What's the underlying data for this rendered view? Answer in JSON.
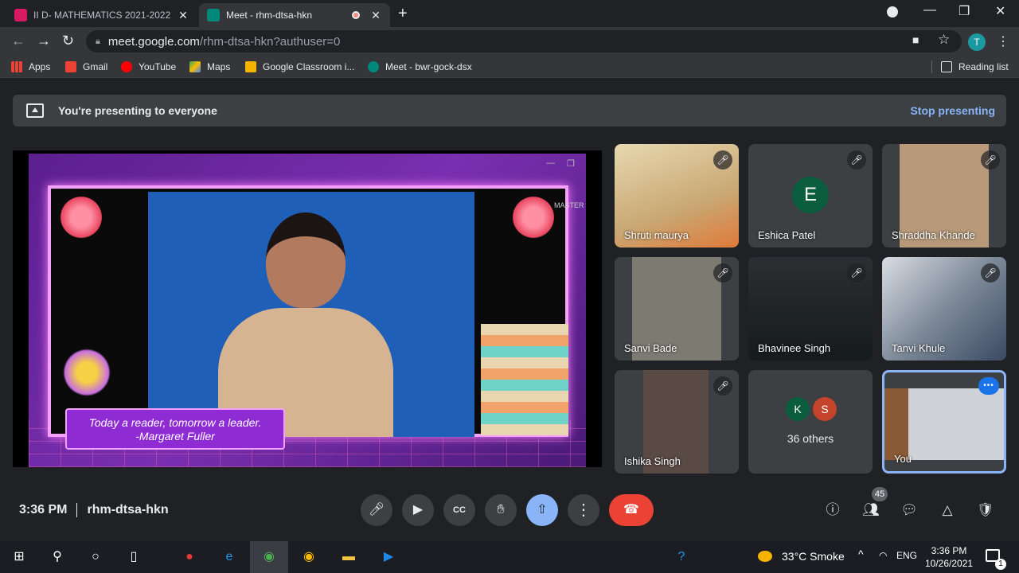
{
  "browser": {
    "tabs": [
      {
        "title": "II D- MATHEMATICS 2021-2022",
        "favicon_color": "#d81b60"
      },
      {
        "title": "Meet - rhm-dtsa-hkn",
        "favicon_color": "#00897b"
      }
    ],
    "url_host": "meet.google.com",
    "url_path": "/rhm-dtsa-hkn?authuser=0",
    "profile_initial": "T",
    "bookmarks": [
      {
        "label": "Apps",
        "icon": "apps-grid-icon"
      },
      {
        "label": "Gmail",
        "icon": "gmail-icon"
      },
      {
        "label": "YouTube",
        "icon": "youtube-icon"
      },
      {
        "label": "Maps",
        "icon": "maps-icon"
      },
      {
        "label": "Google Classroom i...",
        "icon": "classroom-icon"
      },
      {
        "label": "Meet - bwr-gock-dsx",
        "icon": "meet-icon"
      }
    ],
    "reading_list": "Reading list"
  },
  "meet": {
    "banner_text": "You're presenting to everyone",
    "stop_presenting": "Stop presenting",
    "slide_quote_line1": "Today a reader, tomorrow a leader.",
    "slide_quote_line2": "-Margaret Fuller",
    "slide_badge": "MASTER",
    "participants": [
      {
        "name": "Shruti maurya",
        "muted": true,
        "type": "video",
        "bg": "#c9a874"
      },
      {
        "name": "Eshica Patel",
        "muted": true,
        "type": "avatar",
        "initial": "E"
      },
      {
        "name": "Shraddha Khande",
        "muted": true,
        "type": "video",
        "bg": "#8a6a4c"
      },
      {
        "name": "Sanvi Bade",
        "muted": true,
        "type": "video",
        "bg": "#6d6a63"
      },
      {
        "name": "Bhavinee Singh",
        "muted": true,
        "type": "video",
        "bg": "#1d2a2a"
      },
      {
        "name": "Tanvi Khule",
        "muted": true,
        "type": "video",
        "bg": "#7e8a99"
      },
      {
        "name": "Ishika Singh",
        "muted": true,
        "type": "video",
        "bg": "#5a4a45"
      }
    ],
    "others": {
      "label": "36 others",
      "chips": [
        {
          "initial": "K",
          "color": "#0b5d3f"
        },
        {
          "initial": "S",
          "color": "#c5432a"
        }
      ]
    },
    "self_label": "You",
    "time": "3:36 PM",
    "meeting_code": "rhm-dtsa-hkn",
    "participant_count": "45"
  },
  "taskbar": {
    "weather": "33°C  Smoke",
    "lang": "ENG",
    "time": "3:36 PM",
    "date": "10/26/2021",
    "notifications": "1"
  }
}
